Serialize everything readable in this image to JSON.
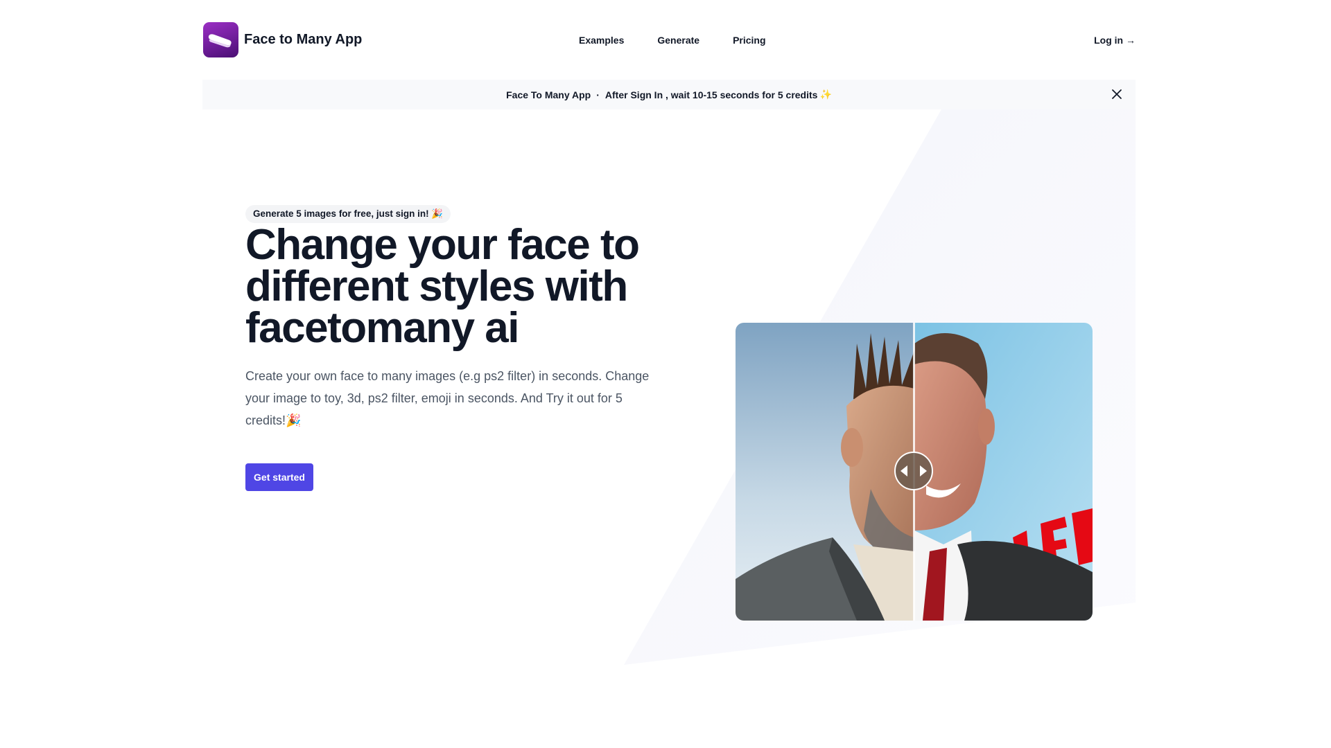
{
  "header": {
    "app_name": "Face to Many App",
    "logo_icon": "app-logo-icon",
    "nav": [
      {
        "label": "Examples"
      },
      {
        "label": "Generate"
      },
      {
        "label": "Pricing"
      }
    ],
    "login_label": "Log in →"
  },
  "banner": {
    "app_label": "Face To Many App",
    "separator": "·",
    "message": "After Sign In , wait 10-15 seconds for 5 credits",
    "sparkle": "✨",
    "close_icon": "close-icon"
  },
  "hero": {
    "pill_text": "Generate 5 images for free, just sign in! 🎉",
    "headline_lines": [
      "Change your face to",
      "different styles with",
      "facetomany ai"
    ],
    "description": "Create your own face to many images (e.g ps2 filter) in seconds. Change your image to toy, 3d, ps2 filter, emoji in seconds. And Try it out for 5 credits!🎉",
    "cta_label": "Get started"
  },
  "comparison": {
    "handle_icon": "compare-arrows-icon",
    "accent_color": "#4f46e5"
  }
}
